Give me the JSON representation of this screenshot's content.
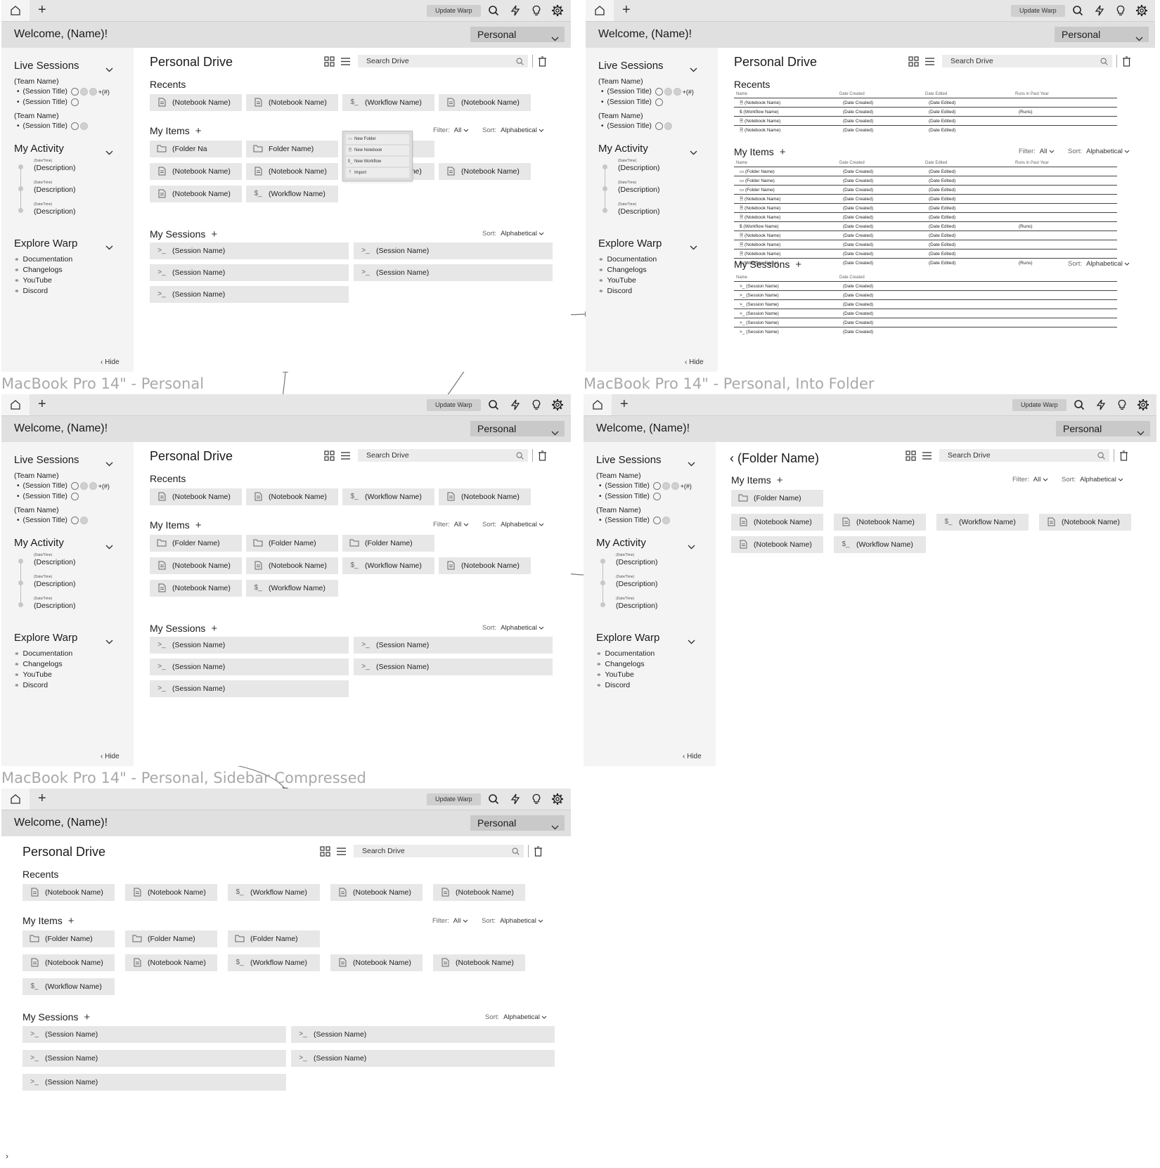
{
  "frames": {
    "personal": "MacBook Pro 14\" - Personal",
    "into_folder": "MacBook Pro 14\" - Personal, Into Folder",
    "sidebar_compressed": "MacBook Pro 14\" - Personal, Sidebar Compressed"
  },
  "topbar": {
    "update_label": "Update Warp"
  },
  "header": {
    "welcome": "Welcome, (Name)!",
    "workspace": "Personal"
  },
  "sidebar": {
    "live_sessions": "Live Sessions",
    "team_name": "(Team Name)",
    "session_title": "(Session Title)",
    "plus_count": "+(#)",
    "my_activity": "My Activity",
    "datetime": "(Date/Time)",
    "description": "(Description)",
    "explore_warp": "Explore Warp",
    "links": [
      "Documentation",
      "Changelogs",
      "YouTube",
      "Discord"
    ],
    "hide": "Hide"
  },
  "main": {
    "title": "Personal Drive",
    "folder_title": "(Folder Name)",
    "search_placeholder": "Search Drive",
    "recents": "Recents",
    "my_items": "My Items",
    "my_sessions": "My Sessions",
    "filter_label": "Filter:",
    "filter_value": "All",
    "sort_label": "Sort:",
    "sort_value": "Alphabetical"
  },
  "items": {
    "notebook": "(Notebook Name)",
    "workflow": "(Workflow Name)",
    "folder": "(Folder Name)",
    "session": "(Session Name)",
    "folder_clipped": "(Folder Na",
    "folder_clipped_b": "Folder Name)",
    "notebook_clipped": "(Notebook Name)"
  },
  "new_menu": [
    "New Folder",
    "New Notebook",
    "New Workflow",
    "Import"
  ],
  "list": {
    "col_name": "Name",
    "col_created": "Date Created",
    "col_edited": "Date Edited",
    "col_runs": "Runs in Past Year",
    "date_created": "(Date Created)",
    "date_edited": "(Date Edited)",
    "runs": "(Runs)"
  },
  "icons": {
    "home": "home-icon",
    "search": "search-icon",
    "bolt": "bolt-icon",
    "bulb": "lightbulb-icon",
    "gear": "gear-icon",
    "grid": "grid-view-icon",
    "list": "list-view-icon",
    "trash": "trash-icon",
    "link": "link-icon",
    "notebook": "notebook-icon",
    "workflow": "workflow-icon",
    "folder": "folder-icon",
    "terminal": "terminal-icon",
    "chevron": "chevron-down-icon",
    "back": "chevron-left-icon"
  }
}
